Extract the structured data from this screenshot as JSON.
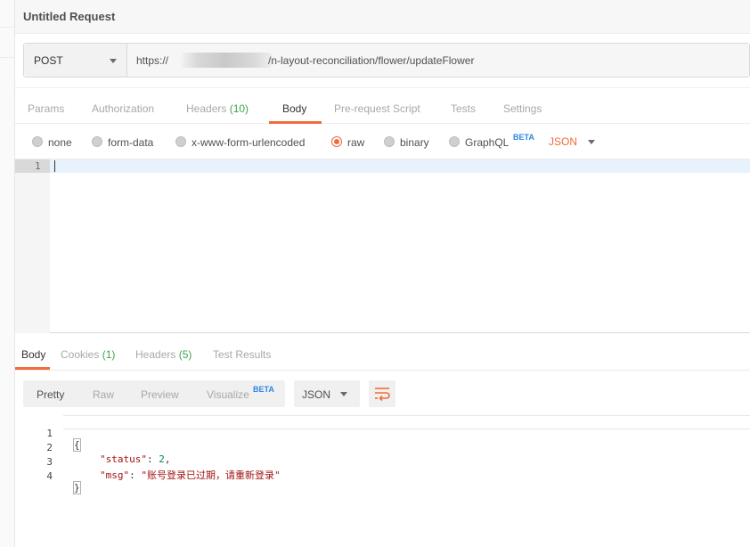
{
  "request": {
    "title": "Untitled Request",
    "method": "POST",
    "url_start": "https://",
    "url_end": "/n-layout-reconciliation/flower/updateFlower"
  },
  "request_tabs": [
    {
      "label": "Params",
      "count": ""
    },
    {
      "label": "Authorization",
      "count": ""
    },
    {
      "label": "Headers",
      "count": "(10)"
    },
    {
      "label": "Body",
      "count": "",
      "active": true
    },
    {
      "label": "Pre-request Script",
      "count": ""
    },
    {
      "label": "Tests",
      "count": ""
    },
    {
      "label": "Settings",
      "count": ""
    }
  ],
  "body_options": {
    "none": "none",
    "form_data": "form-data",
    "urlencoded": "x-www-form-urlencoded",
    "raw": "raw",
    "binary": "binary",
    "graphql": "GraphQL",
    "beta": "BETA",
    "format": "JSON",
    "selected": "raw"
  },
  "editor": {
    "line_number": "1"
  },
  "response_tabs": [
    {
      "label": "Body",
      "count": "",
      "active": true
    },
    {
      "label": "Cookies",
      "count": "(1)"
    },
    {
      "label": "Headers",
      "count": "(5)"
    },
    {
      "label": "Test Results",
      "count": ""
    }
  ],
  "response_toolbar": {
    "pretty": "Pretty",
    "raw": "Raw",
    "preview": "Preview",
    "visualize": "Visualize",
    "beta": "BETA",
    "format": "JSON",
    "wrap_icon": "wrap-lines-icon"
  },
  "response_body": {
    "lines": [
      {
        "n": "1",
        "open": "{"
      },
      {
        "n": "2",
        "key": "\"status\"",
        "sep": ": ",
        "value": "2",
        "tail": ","
      },
      {
        "n": "3",
        "key": "\"msg\"",
        "sep": ": ",
        "value": "\"账号登录已过期，请重新登录\"",
        "tail": ""
      },
      {
        "n": "4",
        "close": "}"
      }
    ]
  },
  "colors": {
    "accent": "#f26b3a",
    "count_green": "#3fa34d",
    "beta_blue": "#2e86de"
  }
}
